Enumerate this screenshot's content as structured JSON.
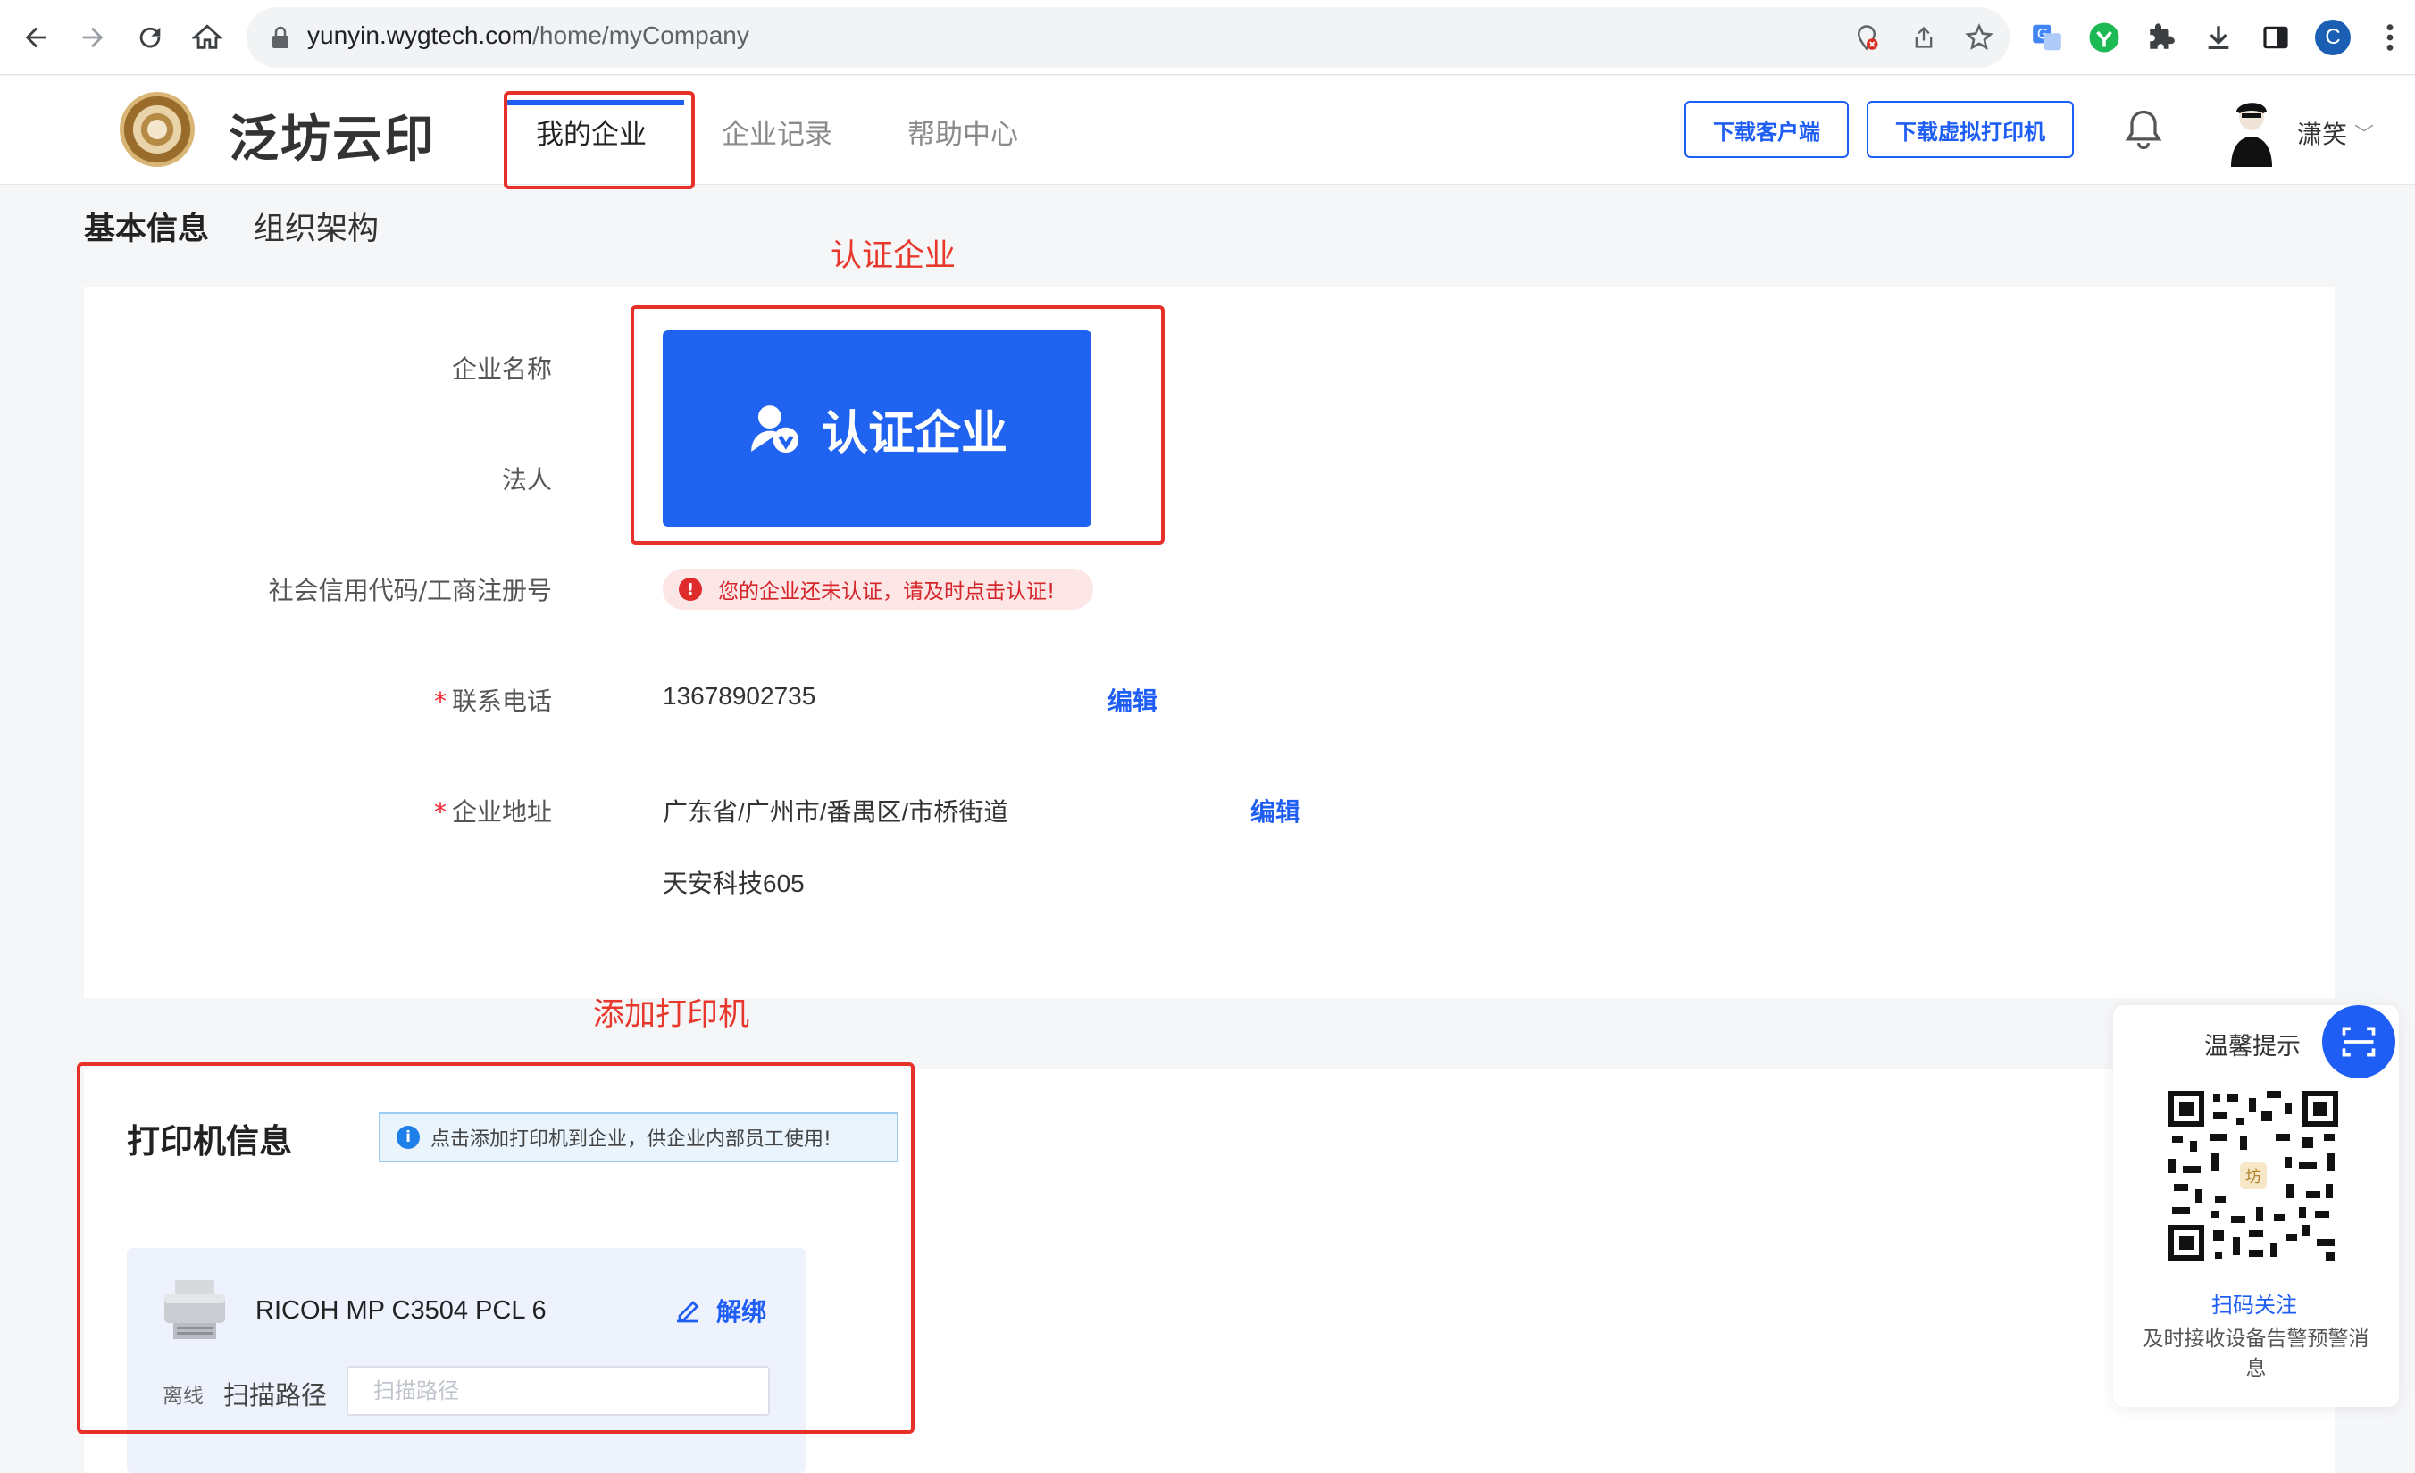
{
  "browser": {
    "url_host": "yunyin.wygtech.com",
    "url_path": "/home/myCompany",
    "profile_initial": "C"
  },
  "header": {
    "brand": "泛坊云印",
    "tabs": [
      "我的企业",
      "企业记录",
      "帮助中心"
    ],
    "active_tab": "我的企业",
    "download_client": "下载客户端",
    "download_virtual_printer": "下载虚拟打印机",
    "username": "潇笑",
    "user_chevron": "﹀"
  },
  "section_tabs": [
    "基本信息",
    "组织架构"
  ],
  "annotations": {
    "certify": "认证企业",
    "add_printer": "添加打印机"
  },
  "company": {
    "labels": {
      "name": "企业名称",
      "legal_person": "法人",
      "credit_code": "社会信用代码/工商注册号",
      "phone": "联系电话",
      "address": "企业地址"
    },
    "required_mark": "*",
    "certify_button": "认证企业",
    "warning": "您的企业还未认证，请及时点击认证!",
    "warning_icon": "!",
    "phone": "13678902735",
    "address_line1": "广东省/广州市/番禺区/市桥街道",
    "address_line2": "天安科技605",
    "edit_label": "编辑"
  },
  "printer": {
    "title": "打印机信息",
    "tip": "点击添加打印机到企业，供企业内部员工使用!",
    "tip_icon": "i",
    "name": "RICOH MP C3504 PCL 6",
    "unbind": "解绑",
    "status": "离线",
    "scan_label": "扫描路径",
    "scan_placeholder": "扫描路径",
    "scan_value": ""
  },
  "qr_panel": {
    "title": "温馨提示",
    "follow": "扫码关注",
    "desc": "及时接收设备告警预警消息",
    "center_char": "坊"
  },
  "colors": {
    "primary": "#1f5ef5",
    "annotation_red": "#e8302a",
    "warning_red": "#d4262b"
  },
  "icons": [
    "back-arrow-icon",
    "forward-arrow-icon",
    "reload-icon",
    "home-icon",
    "lock-icon",
    "location-blocked-icon",
    "share-icon",
    "star-icon",
    "translate-icon",
    "extension-green-icon",
    "puzzle-icon",
    "download-icon",
    "side-panel-icon",
    "bell-icon",
    "user-certify-icon",
    "info-icon",
    "edit-pen-icon",
    "printer-icon",
    "scan-icon"
  ]
}
